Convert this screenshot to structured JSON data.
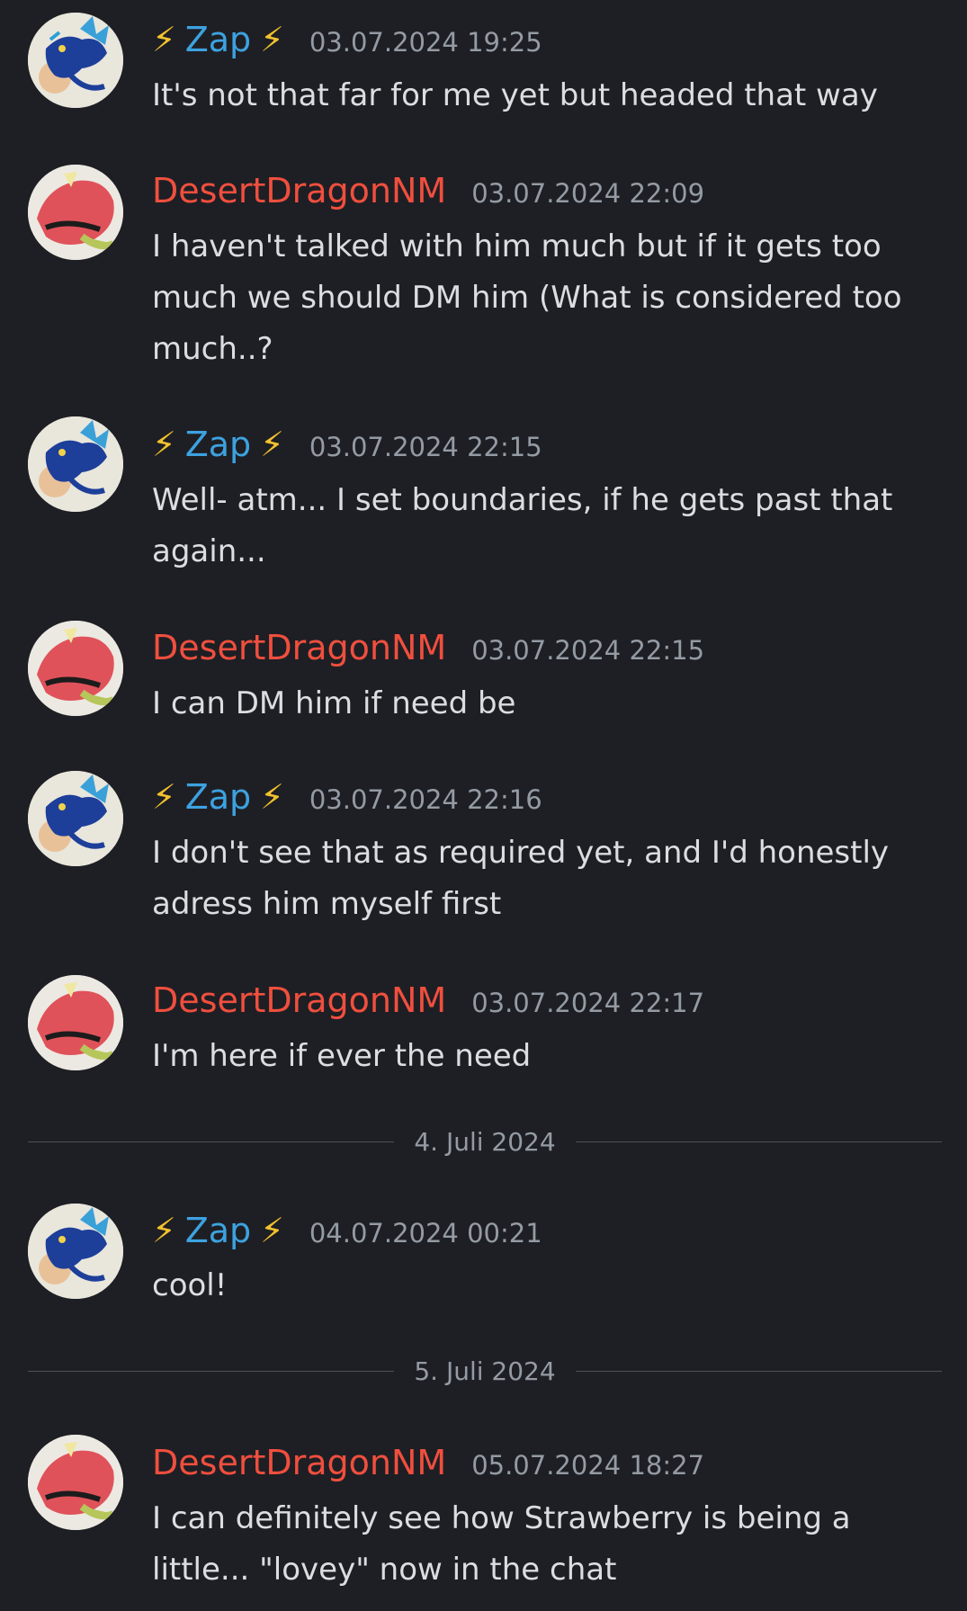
{
  "users": {
    "zap": {
      "name": "Zap",
      "bolt": "⚡",
      "color": "#3da2e0"
    },
    "dd": {
      "name": "DesertDragonNM",
      "color": "#f04f3e"
    }
  },
  "messages": [
    {
      "author": "Zap",
      "timestamp": "03.07.2024 19:25",
      "text": "It's not that far for me yet but headed that way"
    },
    {
      "author": "DesertDragonNM",
      "timestamp": "03.07.2024 22:09",
      "text": "I haven't talked with him much but if it gets too much we should DM him (What is considered too much..?"
    },
    {
      "author": "Zap",
      "timestamp": "03.07.2024 22:15",
      "text": "Well- atm... I set boundaries, if he gets past that again..."
    },
    {
      "author": "DesertDragonNM",
      "timestamp": "03.07.2024 22:15",
      "text": "I can DM him if need be"
    },
    {
      "author": "Zap",
      "timestamp": "03.07.2024 22:16",
      "text": "I don't see that as required yet, and I'd honestly adress him myself first"
    },
    {
      "author": "DesertDragonNM",
      "timestamp": "03.07.2024 22:17",
      "text": "I'm here if ever the need"
    },
    {
      "author": "Zap",
      "timestamp": "04.07.2024 00:21",
      "text": "cool!"
    },
    {
      "author": "DesertDragonNM",
      "timestamp": "05.07.2024 18:27",
      "text": "I can definitely see how Strawberry is being a little... \"lovey\" now in the chat"
    }
  ],
  "dividers": [
    "4. Juli 2024",
    "5. Juli 2024"
  ],
  "icons": {
    "zap_avatar": "blue-dragon-avatar-icon",
    "dd_avatar": "red-dragon-avatar-icon",
    "bolt": "lightning-bolt-icon"
  }
}
